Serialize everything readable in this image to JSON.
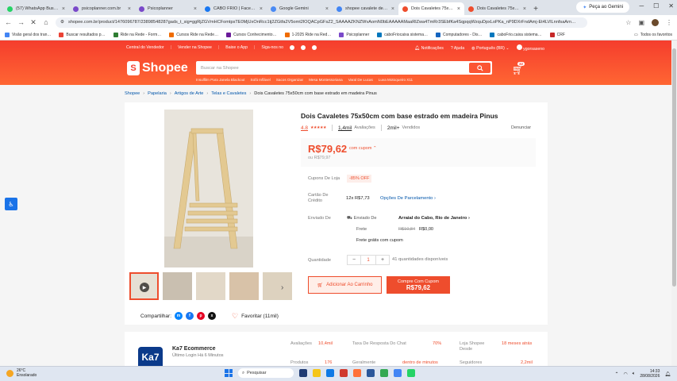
{
  "browser": {
    "tabs": [
      {
        "label": "(57) WhatsApp Busin…",
        "color": "#25d366",
        "active": false
      },
      {
        "label": "psicoplanner.com.br",
        "color": "#7a49c9",
        "active": false
      },
      {
        "label": "Psicoplanner",
        "color": "#7a49c9",
        "active": false
      },
      {
        "label": "CABO FRIO | Facebo…",
        "color": "#1877f2",
        "active": false
      },
      {
        "label": "Google Gemini",
        "color": "#4a8af4",
        "active": false
      },
      {
        "label": "shopee cavalete de…",
        "color": "#4285f4",
        "active": false
      },
      {
        "label": "Dois Cavaletes 75x50…",
        "color": "#ee4d2d",
        "active": true
      },
      {
        "label": "Dois Cavaletes 75x50…",
        "color": "#ee4d2d",
        "active": false
      }
    ],
    "gemini_button": "Peça ao Gemini",
    "url": "shopee.com.br/product/1476096787/23898548287gads_t_sig=ggRjZGVmHCFomtpsTE0MjUxOnRcc1tj2ZGtfa2V5omt2lOQACpGFsZ2_SAAAAZKNZWvAomN0bEAAAAAMaaRlZwa4TmRr3SEbfKa4SqpqqWzquDpxLoPKa_nP9DXrFndAmj-Et4LVlLnnfsaArn…",
    "bookmarks": [
      "Visão geral dos tran…",
      "Buscar resultados p…",
      "Ride na Rede - Form…",
      "Cursos Ride na Rede…",
      "Cursos Conhecimento…",
      "1-2025 Ride na Red…",
      "Psicoplanner",
      "caboFriocaixa sistema…",
      "Computadores - Dis…",
      "caboFrio.caixa sistema…",
      "CRF"
    ],
    "bookmarks_right": "Todos os favoritos"
  },
  "shopee": {
    "topnav": [
      "Central do Vendedor",
      "Vender na Shopee",
      "Baixe o App",
      "Siga-nos no"
    ],
    "notifications": "Notificações",
    "help": "Ajuda",
    "language": "Português (BR)",
    "username": "ygorsaseno",
    "logo_text": "Shopee",
    "search_placeholder": "Buscar na Shopee",
    "suggestions": [
      "Insulfilm Para Janela Blackout",
      "Sofá Inflável",
      "Sacos Organizar",
      "Mesa Montessoriana",
      "Varal De Lucas",
      "Luva Motoqueiro X11"
    ],
    "cart_count": "32"
  },
  "breadcrumb": [
    "Shopee",
    "Papelaria",
    "Artigos de Arte",
    "Telas e Cavaletes",
    "Dois Cavaletes 75x50cm com base estrado em madeira Pinus"
  ],
  "product": {
    "title": "Dois Cavaletes 75x50cm com base estrado em madeira Pinus",
    "rating": "4.8",
    "stars": "★★★★★",
    "reviews_count": "1,4mil",
    "reviews_label": "Avaliações",
    "sold_count": "2mil+",
    "sold_label": "Vendidos",
    "report": "Denunciar",
    "price": "R$79,62",
    "price_note": "com cupom ⌃",
    "old_price": "ou R$79,97",
    "coupon_label": "Cupons De Loja",
    "coupon_value": "-85% OFF",
    "credit_label": "Cartão De Crédito",
    "installments": "12x R$7,73",
    "installment_options": "Opções De Parcelamento",
    "shipping_label": "Enviado De",
    "ship_from_label": "Enviado De",
    "ship_from_value": "Arraial do Cabo, Rio de Janeiro",
    "freight_label": "Frete",
    "freight_old": "R$10,84",
    "freight_new": "R$0,00",
    "free_shipping": "Frete grátis com cupom",
    "quantity_label": "Quantidade",
    "quantity": "1",
    "available": "41 quantidades disponíveis",
    "add_to_cart": "Adicionar Ao Carrinho",
    "buy_with_coupon": "Compre Com Cupom",
    "buy_price": "R$79,62",
    "share_label": "Compartilhar:",
    "favorite_label": "Favoritar (11mil)"
  },
  "shop": {
    "logo_text": "Ka7",
    "name": "Ka7 Ecommerce",
    "status": "Último Login Há 6 Minutos",
    "stats": [
      {
        "label": "Avaliações",
        "value": "10,4mil"
      },
      {
        "label": "Taxa De Resposta Do Chat",
        "value": "70%"
      },
      {
        "label": "Loja Shopee Desde",
        "value": "18 meses atrás"
      },
      {
        "label": "Produtos",
        "value": "176"
      },
      {
        "label": "Geralmente",
        "value": "dentro de minutos"
      },
      {
        "label": "Seguidores",
        "value": "2,2mil"
      }
    ]
  },
  "taskbar": {
    "temp": "26°C",
    "weather": "Ensolarado",
    "search": "Pesquisar",
    "time": "14:33",
    "date": "28/08/2026"
  }
}
